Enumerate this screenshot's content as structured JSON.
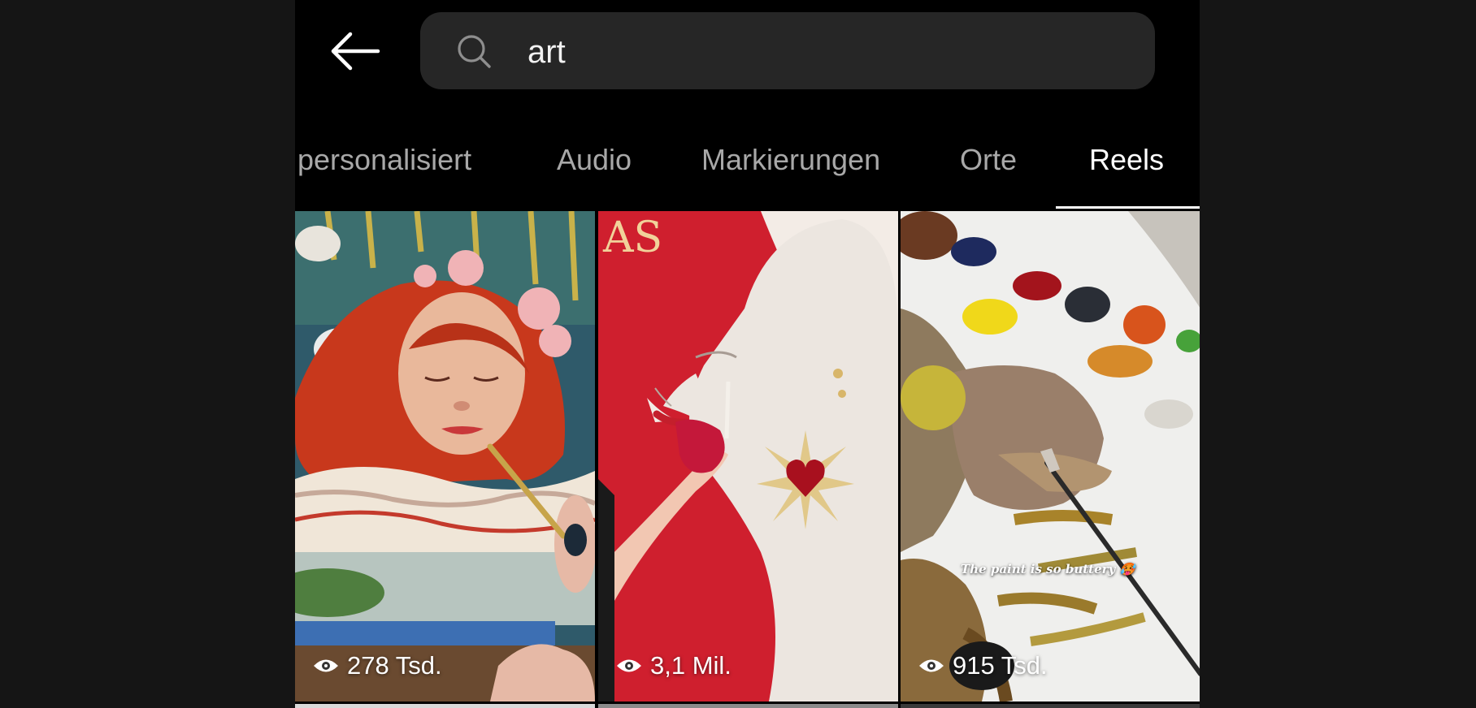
{
  "search": {
    "query": "art"
  },
  "tabs": [
    {
      "label": "personalisiert",
      "active": false
    },
    {
      "label": "Audio",
      "active": false
    },
    {
      "label": "Markierungen",
      "active": false
    },
    {
      "label": "Orte",
      "active": false
    },
    {
      "label": "Reels",
      "active": true
    }
  ],
  "reels": [
    {
      "views": "278 Tsd.",
      "caption": ""
    },
    {
      "views": "3,1 Mil.",
      "caption": "AS"
    },
    {
      "views": "915 Tsd.",
      "caption": "The paint is so buttery 🥵"
    }
  ],
  "icons": {
    "back": "arrow-left-icon",
    "search": "search-icon",
    "views": "eye-icon"
  },
  "colors": {
    "background": "#000000",
    "search_bg": "#262626",
    "tab_inactive": "#a8a8a8",
    "tab_active": "#ffffff"
  }
}
